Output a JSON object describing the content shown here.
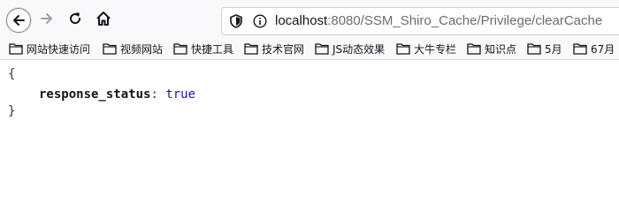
{
  "browser": {
    "url_host": "localhost",
    "url_rest": ":8080/SSM_Shiro_Cache/Privilege/clearCache",
    "icons": [
      "back-arrow-icon",
      "forward-arrow-icon",
      "reload-icon",
      "home-icon",
      "shield-icon",
      "info-icon",
      "folder-icon"
    ]
  },
  "bookmarks": [
    {
      "label": "网站快速访问"
    },
    {
      "label": "视频网站"
    },
    {
      "label": "快捷工具"
    },
    {
      "label": "技术官网"
    },
    {
      "label": "JS动态效果"
    },
    {
      "label": "大牛专栏"
    },
    {
      "label": "知识点"
    },
    {
      "label": "5月"
    },
    {
      "label": "67月"
    }
  ],
  "json_view": {
    "open_brace": "{",
    "key": "response_status",
    "colon": ":",
    "value": "true",
    "close_brace": "}"
  }
}
